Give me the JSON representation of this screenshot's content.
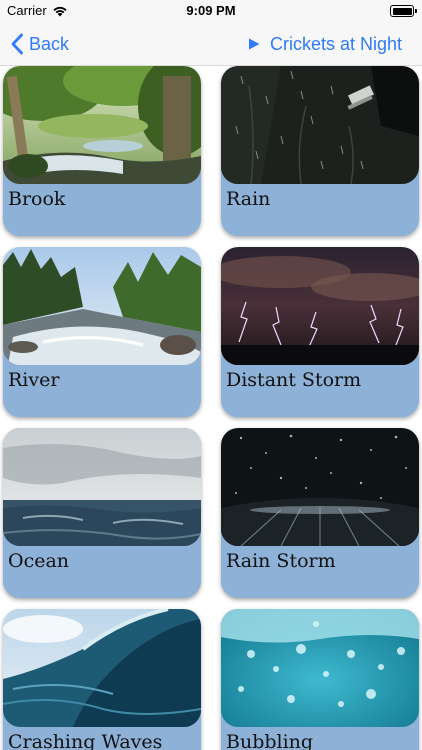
{
  "status_bar": {
    "carrier": "Carrier",
    "time": "9:09 PM"
  },
  "nav": {
    "back_label": "Back",
    "now_playing": "Crickets at Night"
  },
  "sounds": [
    {
      "label": "Brook"
    },
    {
      "label": "Rain"
    },
    {
      "label": "River"
    },
    {
      "label": "Distant Storm"
    },
    {
      "label": "Ocean"
    },
    {
      "label": "Rain Storm"
    },
    {
      "label": "Crashing Waves"
    },
    {
      "label": "Bubbling"
    }
  ],
  "colors": {
    "accent": "#2f7bf6",
    "card_background": "#8eb1d7"
  },
  "icons": {
    "back": "chevron-left-icon",
    "now_playing": "play-icon",
    "wifi": "wifi-icon",
    "battery": "battery-icon"
  }
}
